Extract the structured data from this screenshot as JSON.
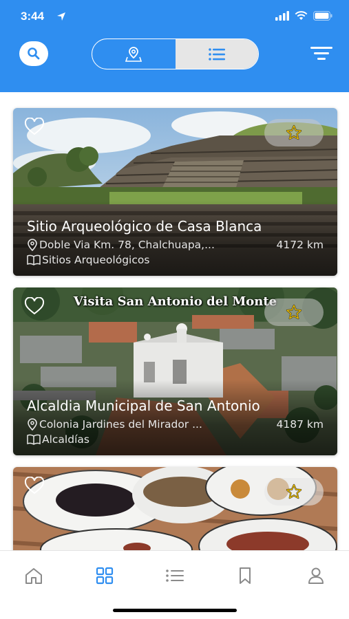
{
  "status_bar": {
    "time": "3:44"
  },
  "header": {
    "search_icon": "search-icon",
    "segments": [
      {
        "icon": "map-pin-icon",
        "active": false
      },
      {
        "icon": "list-icon",
        "active": true
      }
    ],
    "filter_icon": "filter-icon"
  },
  "places": [
    {
      "title": "Sitio Arqueológico de Casa Blanca",
      "address": "Doble Via Km. 78, Chalchuapa,...",
      "distance": "4172 km",
      "category": "Sitios Arqueológicos",
      "banner": ""
    },
    {
      "title": "Alcaldia Municipal de San Antonio",
      "address": "Colonia Jardines del Mirador ...",
      "distance": "4187 km",
      "category": "Alcaldías",
      "banner": "Visita San Antonio del Monte"
    },
    {
      "title": "",
      "address": "",
      "distance": "",
      "category": "",
      "banner": ""
    }
  ],
  "tabs": [
    {
      "icon": "home-icon",
      "active": false
    },
    {
      "icon": "grid-icon",
      "active": true
    },
    {
      "icon": "list-icon",
      "active": false
    },
    {
      "icon": "bookmark-icon",
      "active": false
    },
    {
      "icon": "profile-icon",
      "active": false
    }
  ],
  "colors": {
    "header": "#2f8ef0",
    "accent": "#2f8ef0",
    "star": "#f2c200",
    "tab_inactive": "#8a8a8a"
  }
}
